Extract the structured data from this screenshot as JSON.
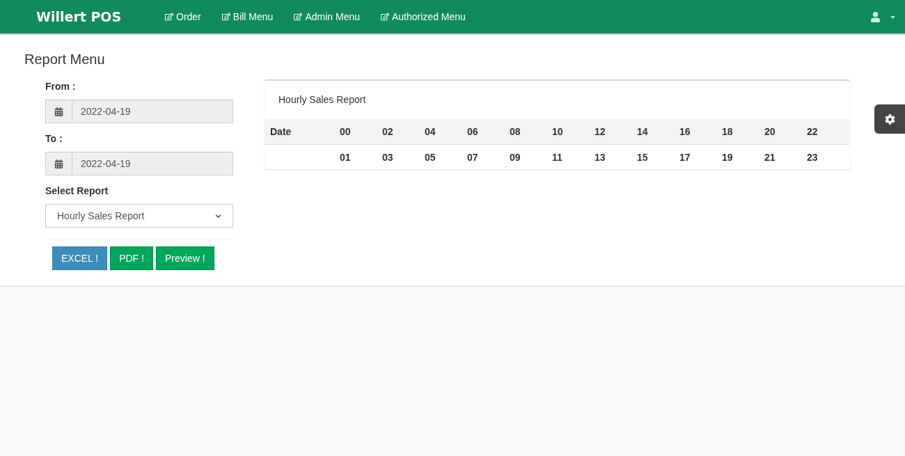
{
  "navbar": {
    "brand": "Willert POS",
    "items": [
      {
        "label": "Order"
      },
      {
        "label": "Bill Menu"
      },
      {
        "label": "Admin Menu"
      },
      {
        "label": "Authorized Menu"
      }
    ]
  },
  "page_title": "Report Menu",
  "form": {
    "from": {
      "label": "From :",
      "value": "2022-04-19"
    },
    "to": {
      "label": "To :",
      "value": "2022-04-19"
    },
    "select": {
      "label": "Select Report",
      "value": "Hourly Sales Report"
    },
    "buttons": [
      {
        "label": "EXCEL !",
        "kind": "info"
      },
      {
        "label": "PDF !",
        "kind": "success"
      },
      {
        "label": "Preview !",
        "kind": "success"
      }
    ]
  },
  "report": {
    "title": "Hourly Sales Report",
    "columns": [
      {
        "header": "Date"
      },
      {
        "header": "00",
        "sub": "01"
      },
      {
        "header": "02",
        "sub": "03"
      },
      {
        "header": "04",
        "sub": "05"
      },
      {
        "header": "06",
        "sub": "07"
      },
      {
        "header": "08",
        "sub": "09"
      },
      {
        "header": "10",
        "sub": "11"
      },
      {
        "header": "12",
        "sub": "13"
      },
      {
        "header": "14",
        "sub": "15"
      },
      {
        "header": "16",
        "sub": "17"
      },
      {
        "header": "18",
        "sub": "19"
      },
      {
        "header": "20",
        "sub": "21"
      },
      {
        "header": "22",
        "sub": "23"
      }
    ]
  }
}
